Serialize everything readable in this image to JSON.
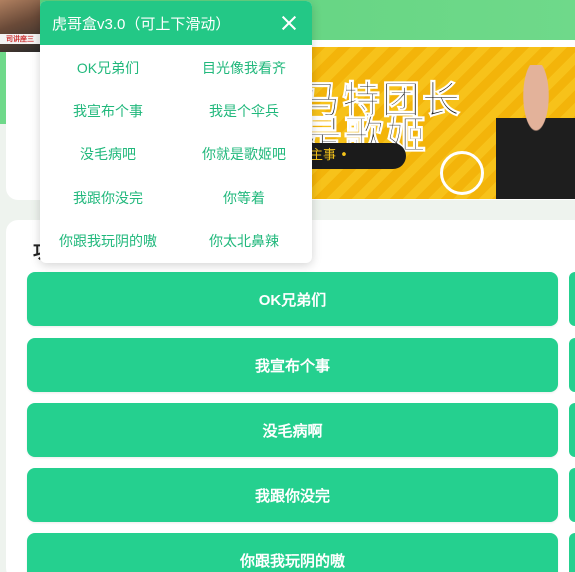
{
  "popup": {
    "title": "虎哥盒v3.0（可上下滑动）",
    "items": [
      {
        "label": "OK兄弟们"
      },
      {
        "label": "目光像我看齐"
      },
      {
        "label": "我宣布个事"
      },
      {
        "label": "我是个伞兵"
      },
      {
        "label": "没毛病吧"
      },
      {
        "label": "你就是歌姬吧"
      },
      {
        "label": "我跟你没完"
      },
      {
        "label": "你等着"
      },
      {
        "label": "你跟我玩阴的嗷"
      },
      {
        "label": "你太北鼻辣"
      }
    ]
  },
  "avatar": {
    "caption": "司讲座三"
  },
  "banner": {
    "line1": "马特团长",
    "line2": "是歌姬",
    "pill": "主事 •"
  },
  "section": {
    "heading_char": "功"
  },
  "buttons": [
    {
      "label": "OK兄弟们"
    },
    {
      "label": "我宣布个事"
    },
    {
      "label": "没毛病啊"
    },
    {
      "label": "我跟你没完"
    },
    {
      "label": "你跟我玩阴的嗷"
    }
  ],
  "colors": {
    "accent": "#25d08f",
    "header_green": "#23c886",
    "item_text": "#21b87c",
    "banner_yellow": "#f7c21a"
  }
}
